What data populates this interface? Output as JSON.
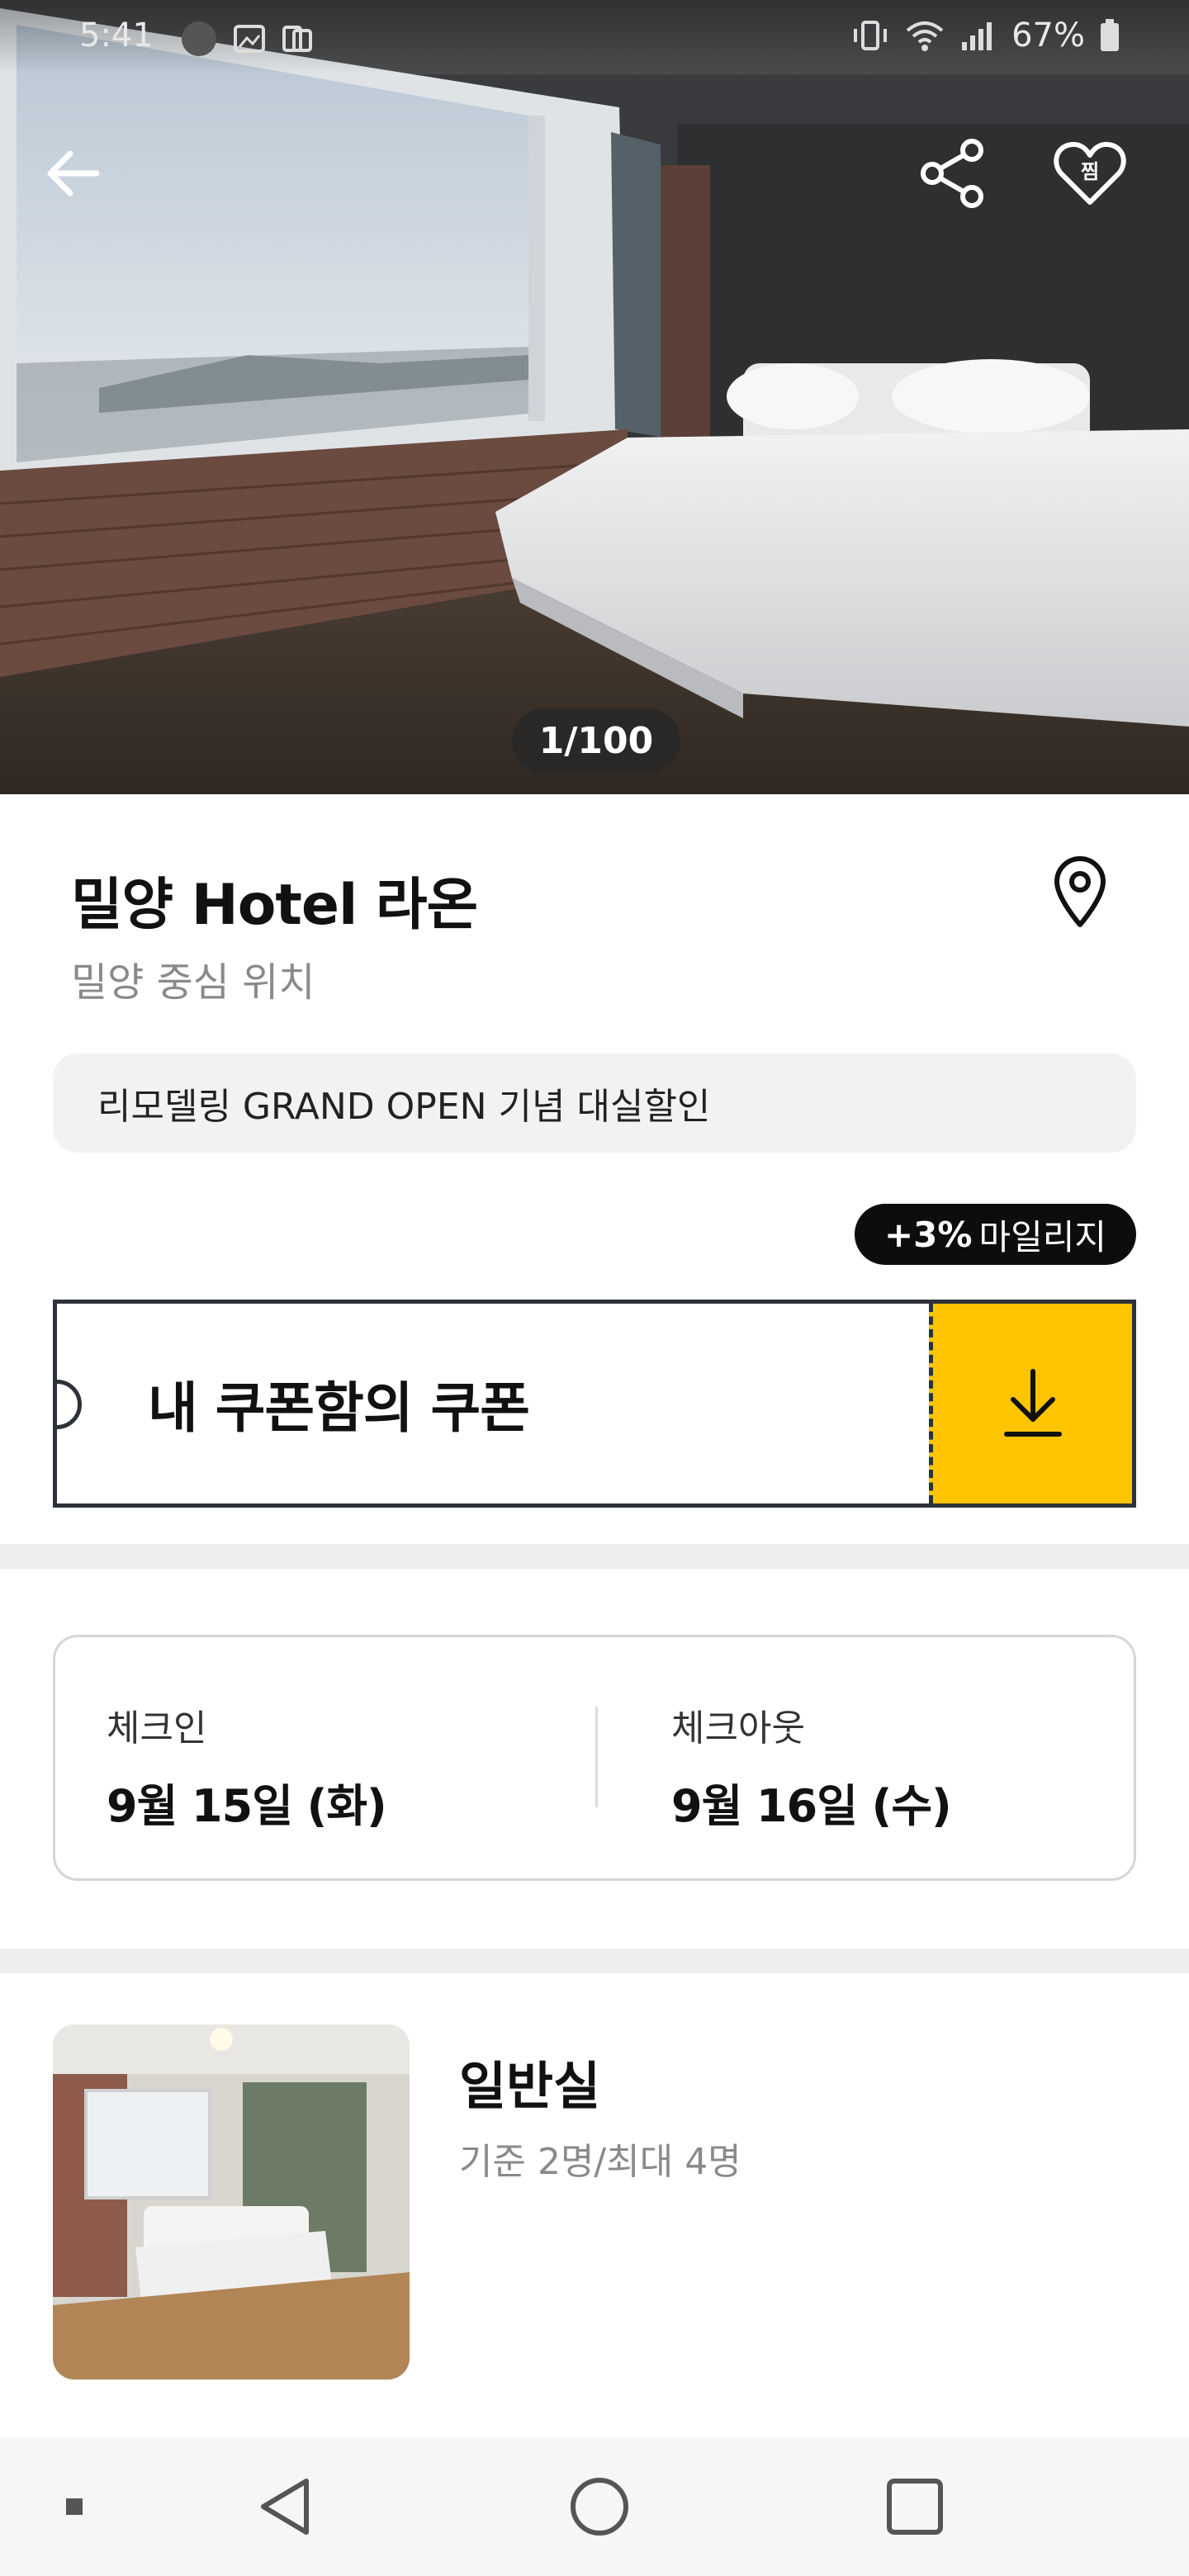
{
  "status_bar": {
    "time": "5:41",
    "battery": "67%"
  },
  "hero": {
    "photo_counter": "1/100"
  },
  "hotel": {
    "name": "밀양 Hotel 라온",
    "subtitle": "밀양 중심 위치",
    "notice": "리모델링 GRAND OPEN 기념 대실할인",
    "mileage_percent": "+3%",
    "mileage_label": "마일리지"
  },
  "coupon": {
    "label": "내 쿠폰함의 쿠폰",
    "accent_color": "#ffc400"
  },
  "stay": {
    "checkin_label": "체크인",
    "checkin_date": "9월 15일 (화)",
    "checkout_label": "체크아웃",
    "checkout_date": "9월 16일 (수)"
  },
  "room": {
    "name": "일반실",
    "capacity": "기준 2명/최대 4명"
  },
  "icons": {
    "back": "back-arrow-icon",
    "share": "share-icon",
    "favorite": "heart-icon",
    "favorite_text": "찜",
    "map": "map-pin-icon",
    "download": "download-icon"
  }
}
